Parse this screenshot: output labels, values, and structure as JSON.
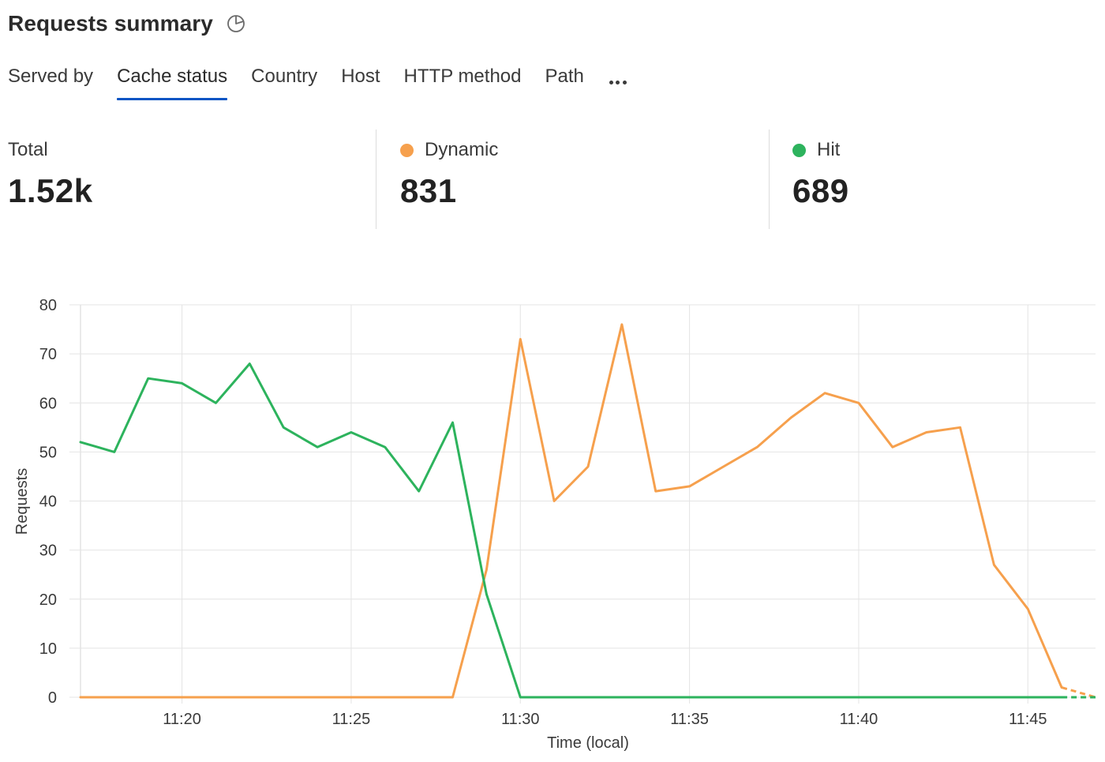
{
  "header": {
    "title": "Requests summary",
    "icon": "pie-chart-icon"
  },
  "tabs": [
    {
      "label": "Served by",
      "active": false
    },
    {
      "label": "Cache status",
      "active": true
    },
    {
      "label": "Country",
      "active": false
    },
    {
      "label": "Host",
      "active": false
    },
    {
      "label": "HTTP method",
      "active": false
    },
    {
      "label": "Path",
      "active": false
    }
  ],
  "more_icon": "ellipsis-icon",
  "stats": {
    "total": {
      "label": "Total",
      "value": "1.52k"
    },
    "dynamic": {
      "label": "Dynamic",
      "value": "831",
      "color": "#f6a04d"
    },
    "hit": {
      "label": "Hit",
      "value": "689",
      "color": "#2db35d"
    }
  },
  "colors": {
    "accent": "#0b55c4",
    "dynamic": "#f6a04d",
    "hit": "#2db35d",
    "grid": "#e4e4e4"
  },
  "chart_data": {
    "type": "line",
    "xlabel": "Time (local)",
    "ylabel": "Requests",
    "ylim": [
      0,
      80
    ],
    "yticks": [
      0,
      10,
      20,
      30,
      40,
      50,
      60,
      70,
      80
    ],
    "x_ticks": [
      "11:20",
      "11:25",
      "11:30",
      "11:35",
      "11:40",
      "11:45"
    ],
    "x_tick_minutes": [
      20,
      25,
      30,
      35,
      40,
      45
    ],
    "x_minutes": [
      17,
      18,
      19,
      20,
      21,
      22,
      23,
      24,
      25,
      26,
      27,
      28,
      29,
      30,
      31,
      32,
      33,
      34,
      35,
      36,
      37,
      38,
      39,
      40,
      41,
      42,
      43,
      44,
      45,
      46,
      47
    ],
    "xlim": [
      17,
      47
    ],
    "grid": true,
    "series": [
      {
        "name": "Dynamic",
        "color": "#f6a04d",
        "values": [
          0,
          0,
          0,
          0,
          0,
          0,
          0,
          0,
          0,
          0,
          0,
          0,
          26,
          73,
          40,
          47,
          76,
          42,
          43,
          47,
          51,
          57,
          62,
          60,
          51,
          54,
          55,
          27,
          18,
          2,
          0
        ],
        "dashed_last": true
      },
      {
        "name": "Hit",
        "color": "#2db35d",
        "values": [
          52,
          50,
          65,
          64,
          60,
          68,
          55,
          51,
          54,
          51,
          42,
          56,
          21,
          0,
          0,
          0,
          0,
          0,
          0,
          0,
          0,
          0,
          0,
          0,
          0,
          0,
          0,
          0,
          0,
          0,
          0
        ],
        "dashed_last": true
      }
    ]
  }
}
